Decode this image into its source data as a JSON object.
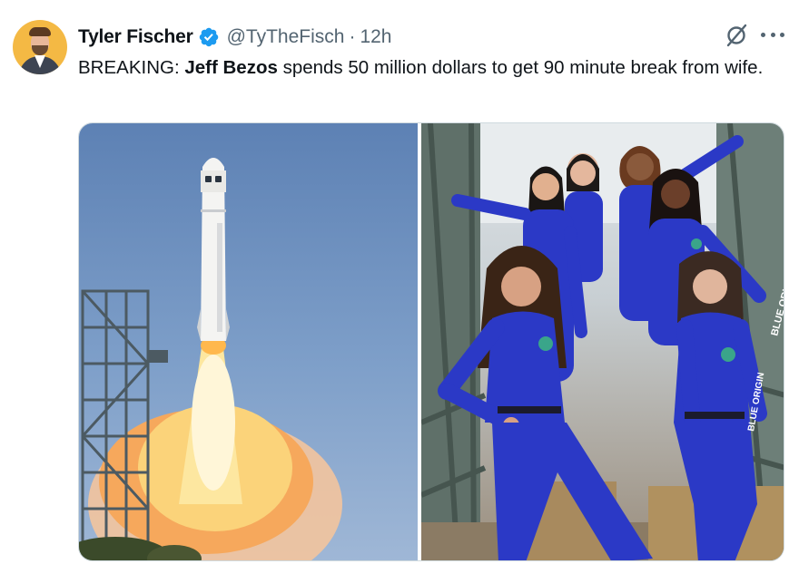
{
  "author": {
    "name": "Tyler Fischer",
    "handle": "@TyTheFisch",
    "separator": "·",
    "time": "12h",
    "verified": true,
    "avatar_icon": "avatar-portrait"
  },
  "tweet": {
    "text_prefix": "BREAKING: ",
    "text_bold": "Jeff Bezos",
    "text_suffix": " spends 50 million dollars to get 90 minute break from wife."
  },
  "media": {
    "images": [
      {
        "label": "rocket-launch-photo"
      },
      {
        "label": "crew-group-photo"
      }
    ],
    "suit_text": "BLUE ORIGIN"
  },
  "icons": {
    "verified": "verified-badge-icon",
    "grok": "grok-icon",
    "more": "more-icon"
  },
  "colors": {
    "verified_blue": "#1d9bf0",
    "text": "#0f1419",
    "secondary": "#536471",
    "suit_blue": "#2b39c6"
  }
}
